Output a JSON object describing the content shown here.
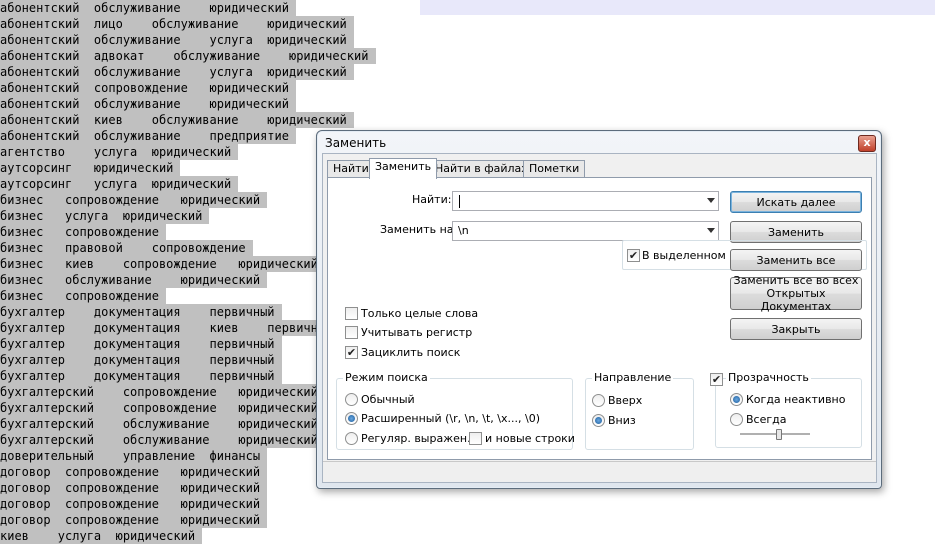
{
  "editor": {
    "lines": [
      "абонентский  обслуживание    юридический",
      "абонентский  лицо    обслуживание    юридический",
      "абонентский  обслуживание    услуга  юридический",
      "абонентский  адвокат    обслуживание    юридический",
      "абонентский  обслуживание    услуга  юридический",
      "абонентский  сопровождение   юридический",
      "абонентский  обслуживание    юридический",
      "абонентский  киев    обслуживание    юридический",
      "абонентский  обслуживание    предприятие",
      "агентство    услуга  юридический",
      "аутсорсинг   юридический",
      "аутсорсинг   услуга  юридический",
      "бизнес   сопровождение   юридический",
      "бизнес   услуга  юридический",
      "бизнес   сопровождение",
      "бизнес   правовой    сопровождение",
      "бизнес   киев    сопровождение   юридический",
      "бизнес   обслуживание    юридический",
      "бизнес   сопровождение",
      "бухгалтер    документация    первичный",
      "бухгалтер    документация    киев    первичный",
      "бухгалтер    документация    первичный",
      "бухгалтер    документация    первичный",
      "бухгалтер    документация    первичный",
      "бухгалтерский    сопровождение   юридический",
      "бухгалтерский    сопровождение   юридический",
      "бухгалтерский    обслуживание    юридический",
      "бухгалтерский    обслуживание    юридический",
      "доверительный    управление  финансы",
      "договор  сопровождение   юридический",
      "договор  сопровождение   юридический",
      "договор  сопровождение   юридический",
      "договор  сопровождение   юридический",
      "киев    услуга  юридический"
    ]
  },
  "dialog": {
    "title": "Заменить",
    "close_glyph": "x",
    "tabs": [
      "Найти",
      "Заменить",
      "Найти в файлах",
      "Пометки"
    ],
    "find_label": "Найти:",
    "find_value": "",
    "replace_label": "Заменить на:",
    "replace_value": "\\n",
    "buttons": {
      "find_next": "Искать далее",
      "replace": "Заменить",
      "replace_all": "Заменить все",
      "replace_all_open_line1": "Заменить все во всех",
      "replace_all_open_line2": "Открытых Документах",
      "close": "Закрыть"
    },
    "in_selection": {
      "label": "В выделенном",
      "checked": true
    },
    "options": {
      "whole_words": {
        "label": "Только целые слова",
        "checked": false
      },
      "match_case": {
        "label": "Учитывать регистр",
        "checked": false
      },
      "wrap_around": {
        "label": "Зациклить поиск",
        "checked": true
      }
    },
    "search_mode": {
      "title": "Режим поиска",
      "normal": "Обычный",
      "extended": "Расширенный (\\r, \\n, \\t, \\x..., \\0)",
      "regex": "Регуляр. выражен.",
      "newlines": "и новые строки",
      "selected": "extended"
    },
    "direction": {
      "title": "Направление",
      "up": "Вверх",
      "down": "Вниз",
      "selected": "down"
    },
    "transparency": {
      "label": "Прозрачность",
      "checked": true,
      "on_losing_focus": "Когда неактивно",
      "always": "Всегда",
      "selected": "on_losing_focus",
      "level": 0.55
    }
  }
}
